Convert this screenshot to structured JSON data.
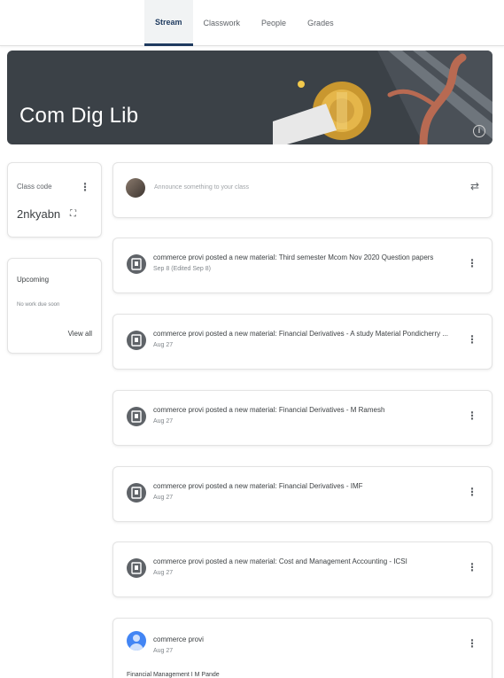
{
  "tabs": [
    {
      "label": "Stream",
      "active": true
    },
    {
      "label": "Classwork"
    },
    {
      "label": "People"
    },
    {
      "label": "Grades"
    }
  ],
  "banner": {
    "title": "Com Dig Lib"
  },
  "class_code": {
    "label": "Class code",
    "code": "2nkyabn"
  },
  "upcoming": {
    "label": "Upcoming",
    "empty": "No work due soon",
    "view_all": "View all"
  },
  "announce": {
    "placeholder": "Announce something to your class"
  },
  "posts": [
    {
      "title": "commerce provi posted a new material: Third semester Mcom Nov 2020 Question papers",
      "date": "Sep 8 (Edited Sep 8)"
    },
    {
      "title": "commerce provi posted a new material: Financial Derivatives - A study Material Pondicherry ...",
      "date": "Aug 27"
    },
    {
      "title": "commerce provi posted a new material: Financial Derivatives - M Ramesh",
      "date": "Aug 27"
    },
    {
      "title": "commerce provi posted a new material: Financial Derivatives - IMF",
      "date": "Aug 27"
    },
    {
      "title": "commerce provi posted a new material: Cost and Management Accounting - ICSI",
      "date": "Aug 27"
    }
  ],
  "last_post": {
    "author": "commerce provi",
    "date": "Aug 27",
    "body": "Financial Management I M Pande"
  },
  "colors": {
    "tab_active": "#1e3a5f",
    "banner_bg": "#3b4147",
    "avatar_blue": "#4285f4"
  }
}
